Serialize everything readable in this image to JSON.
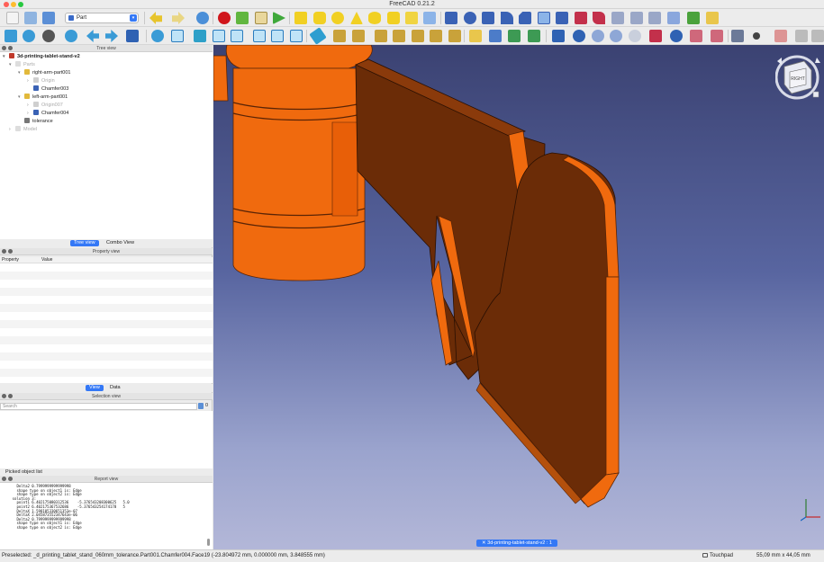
{
  "window": {
    "title": "FreeCAD 0.21.2"
  },
  "toolbar": {
    "workbench_selected": "Part",
    "icons_row1": [
      "new-file-icon",
      "open-file-icon",
      "save-icon",
      "workbench-selector",
      "undo-icon",
      "redo-icon",
      "refresh-icon",
      "record-macro-icon",
      "stop-macro-icon",
      "edit-macro-icon",
      "run-macro-icon",
      "cube-icon",
      "cylinder-icon",
      "sphere-icon",
      "cone-icon",
      "torus-icon",
      "tube-icon",
      "primitives-icon",
      "shape-builder-icon",
      "revolve-icon",
      "mirror-icon",
      "fillet-icon",
      "chamfer-icon",
      "make-face-icon",
      "ruled-surface-icon",
      "loft-icon",
      "sweep-icon",
      "section-icon",
      "cross-sections-icon",
      "offset-icon",
      "thickness-icon",
      "projection-icon",
      "color-icon"
    ],
    "icons_row2": [
      "std-view-fit-icon",
      "fit-selection-icon",
      "draw-style-icon",
      "back-icon",
      "forward-icon",
      "workbench-nav-icon",
      "zoom-icon",
      "isometric-icon",
      "front-view-icon",
      "top-view-icon",
      "right-view-icon",
      "rear-view-icon",
      "bottom-view-icon",
      "left-view-icon",
      "measure-icon",
      "measure-linear-icon",
      "measure-angular-icon",
      "measure-refresh-icon",
      "measure-clear-icon",
      "toggle-3d-icon",
      "toggle-delta-icon",
      "measure-icon-2",
      "part-icon",
      "group-icon",
      "link-icon",
      "link-make-icon",
      "boolean-icon",
      "cut-icon",
      "fuse-icon",
      "common-icon",
      "section-tool-icon",
      "check-geometry-icon",
      "defeaturing-icon",
      "extrude-icon",
      "what-is-this-icon",
      "sketch-settings-icon",
      "cut-clip-icon",
      "copy-icon",
      "paste-icon"
    ]
  },
  "tree": {
    "header": "Tree view",
    "items": [
      {
        "label": "3d-printing-tablet-stand-v2",
        "bold": true
      },
      {
        "label": "Parts",
        "dim": true
      },
      {
        "label": "right-arm-part001"
      },
      {
        "label": "Origin",
        "dim": true
      },
      {
        "label": "Chamfer003"
      },
      {
        "label": "left-arm-part001"
      },
      {
        "label": "Origin007",
        "dim": true
      },
      {
        "label": "Chamfer004"
      },
      {
        "label": "tolerance"
      },
      {
        "label": "Model",
        "dim": true
      }
    ],
    "tabs": [
      "Tree view",
      "Combo View"
    ]
  },
  "property_view": {
    "header": "Property view",
    "columns": [
      "Property",
      "Value"
    ],
    "tabs": [
      "View",
      "Data"
    ]
  },
  "selection_view": {
    "header": "Selection view",
    "search_placeholder": "Search",
    "count": "0",
    "picked_label": "Picked object list"
  },
  "report_view": {
    "header": "Report view",
    "lines": [
      "      Delta2 0.7999999999999998",
      "      shape type on object1 is: Edge",
      "      shape type on object2 is: Edge",
      "    solution 3:",
      "      point1 6.402175080312536    -5.376543208300625   5.0",
      "      point2 6.402175367532686    -5.376543254174178   5",
      "      DeltaX 1.598105330651353e-07",
      "      DeltaX 2.045873552347643e-06",
      "      Delta2 0.7999999999999998",
      "      shape type on object1 is: Edge",
      "      shape type on object2 is: Edge"
    ]
  },
  "viewport": {
    "document_tab": "3d-printing-tablet-stand-v2 : 1",
    "navcube_face": "RIGHT",
    "colors": {
      "part_orange": "#f06a0e",
      "part_dark": "#6b2c07",
      "bg_top": "#3b4272",
      "bg_bottom": "#b3b7d8"
    }
  },
  "statusbar": {
    "text": "Preselected: _d_printing_tablet_stand_060mm_tolerance.Part001.Chamfer004.Face19 (-23.804972 mm, 0.000000 mm, 3.848555 mm)",
    "navigation": "Touchpad",
    "dimensions": "55,09 mm x 44,05 mm"
  }
}
